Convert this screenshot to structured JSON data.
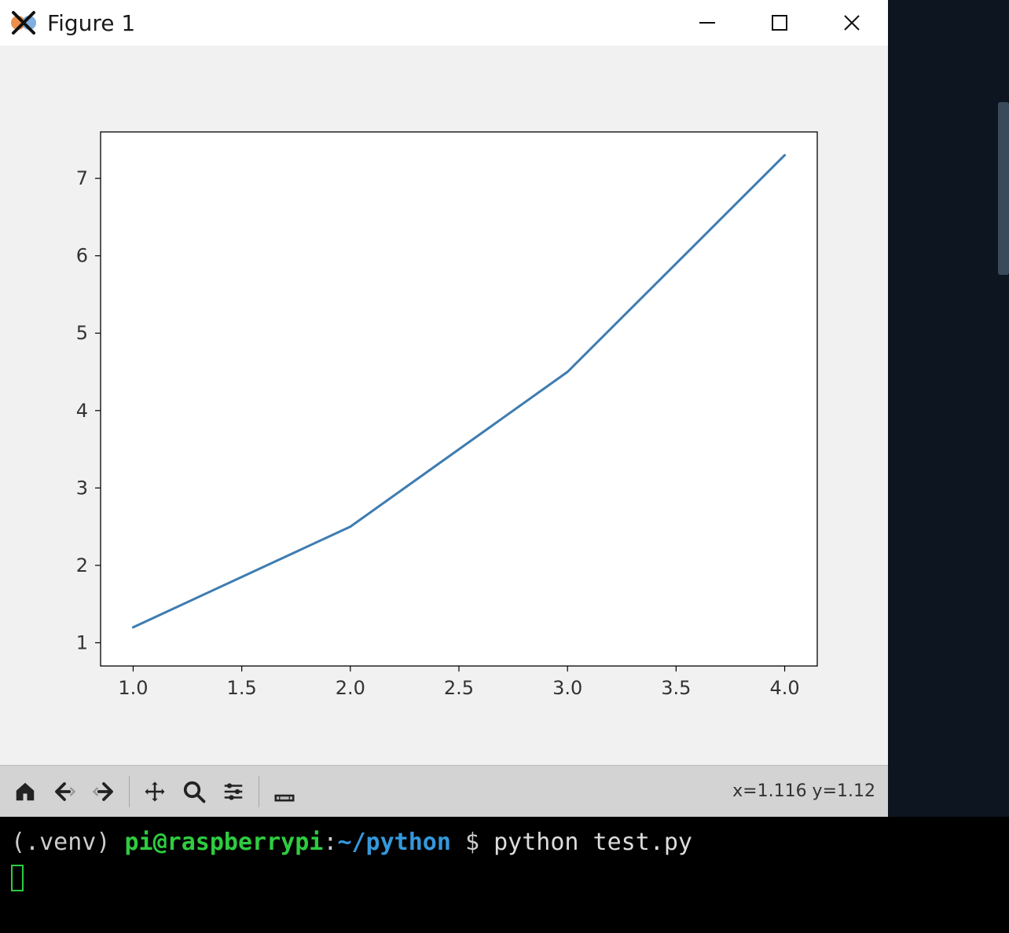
{
  "window": {
    "title": "Figure 1"
  },
  "toolbar": {
    "coord_readout": "x=1.116 y=1.12"
  },
  "terminal": {
    "venv": "(.venv) ",
    "user_host": "pi@raspberrypi",
    "colon": ":",
    "path": "~/python",
    "prompt": " $ ",
    "command": "python test.py"
  },
  "chart_data": {
    "type": "line",
    "x": [
      1.0,
      2.0,
      3.0,
      4.0
    ],
    "y": [
      1.2,
      2.5,
      4.5,
      7.3
    ],
    "xlim": [
      0.85,
      4.15
    ],
    "ylim": [
      0.7,
      7.6
    ],
    "xticks": [
      1.0,
      1.5,
      2.0,
      2.5,
      3.0,
      3.5,
      4.0
    ],
    "yticks": [
      1,
      2,
      3,
      4,
      5,
      6,
      7
    ],
    "xtick_labels": [
      "1.0",
      "1.5",
      "2.0",
      "2.5",
      "3.0",
      "3.5",
      "4.0"
    ],
    "ytick_labels": [
      "1",
      "2",
      "3",
      "4",
      "5",
      "6",
      "7"
    ],
    "line_color": "#3e7cb1",
    "title": "",
    "xlabel": "",
    "ylabel": ""
  }
}
